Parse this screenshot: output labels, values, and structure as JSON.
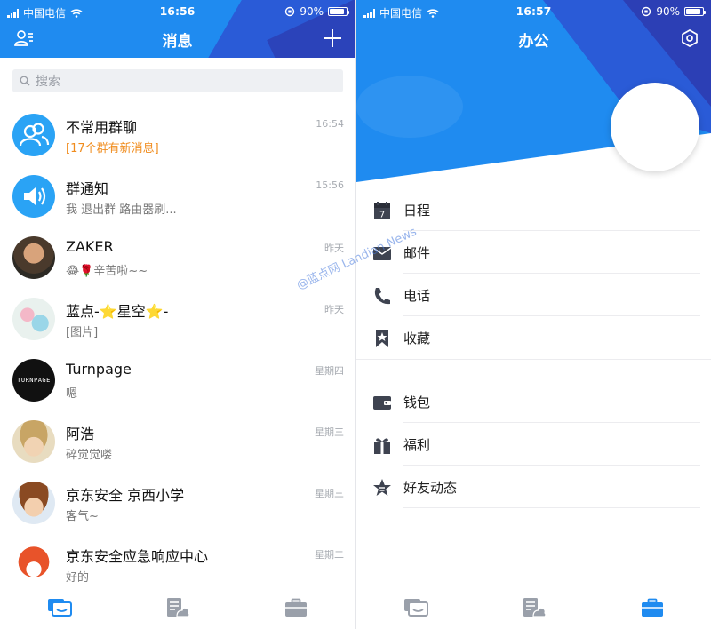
{
  "left_screen": {
    "status": {
      "carrier": "中国电信",
      "time": "16:56",
      "battery": "90%",
      "battery_level": 0.9
    },
    "title": "消息",
    "search_placeholder": "搜索",
    "chats": [
      {
        "name": "不常用群聊",
        "message": "[17个群有新消息]",
        "time": "16:54",
        "highlight": true,
        "avatar": "group-icon"
      },
      {
        "name": "群通知",
        "message": "我 退出群 路由器刷...",
        "time": "15:56",
        "highlight": false,
        "avatar": "speaker-icon"
      },
      {
        "name": "ZAKER",
        "message": "😂🌹辛苦啦~~",
        "time": "昨天",
        "highlight": false,
        "avatar": "photo"
      },
      {
        "name": "蓝点-⭐星空⭐-",
        "message": "[图片]",
        "time": "昨天",
        "highlight": false,
        "avatar": "photo"
      },
      {
        "name": "Turnpage",
        "message": "嗯",
        "time": "星期四",
        "highlight": false,
        "avatar": "logo"
      },
      {
        "name": "阿浩",
        "message": "碎觉觉喽",
        "time": "星期三",
        "highlight": false,
        "avatar": "photo"
      },
      {
        "name": "京东安全 京西小学",
        "message": "客气~",
        "time": "星期三",
        "highlight": false,
        "avatar": "photo"
      },
      {
        "name": "京东安全应急响应中心",
        "message": "好的",
        "time": "星期二",
        "highlight": false,
        "avatar": "photo"
      }
    ],
    "turnpage_logo": "TURNPAGE"
  },
  "right_screen": {
    "status": {
      "carrier": "中国电信",
      "time": "16:57",
      "battery": "90%",
      "battery_level": 0.9
    },
    "title": "办公",
    "menu_group1": [
      {
        "label": "日程",
        "icon": "calendar-icon",
        "badge": "7"
      },
      {
        "label": "邮件",
        "icon": "mail-icon"
      },
      {
        "label": "电话",
        "icon": "phone-icon"
      },
      {
        "label": "收藏",
        "icon": "bookmark-star-icon"
      }
    ],
    "menu_group2": [
      {
        "label": "钱包",
        "icon": "wallet-icon"
      },
      {
        "label": "福利",
        "icon": "gift-icon"
      },
      {
        "label": "好友动态",
        "icon": "star-icon"
      }
    ]
  },
  "watermark": "@蓝点网 Landian.News",
  "colors": {
    "primary": "#1f8bf0",
    "accent_orange": "#f08c1d",
    "dark_blue": "#2c3fb5"
  }
}
